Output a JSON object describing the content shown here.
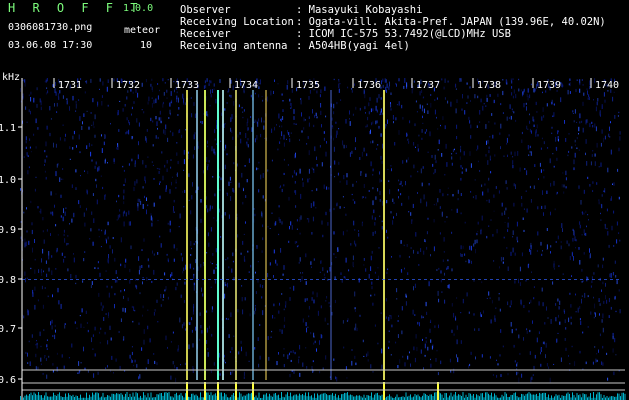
{
  "header": {
    "app_title": "H R O F F T",
    "app_version": "1.0.0",
    "file_name": "0306081730.png",
    "meteor_label": "meteor",
    "capture_time": "03.06.08 17:30",
    "meteor_count": "10"
  },
  "info": {
    "observer_label": "Observer",
    "observer_value": ": Masayuki Kobayashi",
    "location_label": "Receiving Location",
    "location_value": ": Ogata-vill. Akita-Pref. JAPAN (139.96E, 40.02N)",
    "receiver_label": "Receiver",
    "receiver_value": ": ICOM IC-575 53.7492(@LCD)MHz USB",
    "antenna_label": "Receiving antenna",
    "antenna_value": ": A504HB(yagi 4el)"
  },
  "spectrogram": {
    "y_unit": "kHz",
    "y_ticks": [
      "1.1",
      "1.0",
      "0.9",
      "0.8",
      "0.7",
      "0.6"
    ],
    "x_ticks": [
      "1731",
      "1732",
      "1733",
      "1734",
      "1735",
      "1736",
      "1737",
      "1738",
      "1739",
      "1740"
    ],
    "colors": {
      "background": "#000000",
      "noise": "#1a2fd0",
      "strong": "#ffff40",
      "baseline": "#00e0ff"
    }
  }
}
